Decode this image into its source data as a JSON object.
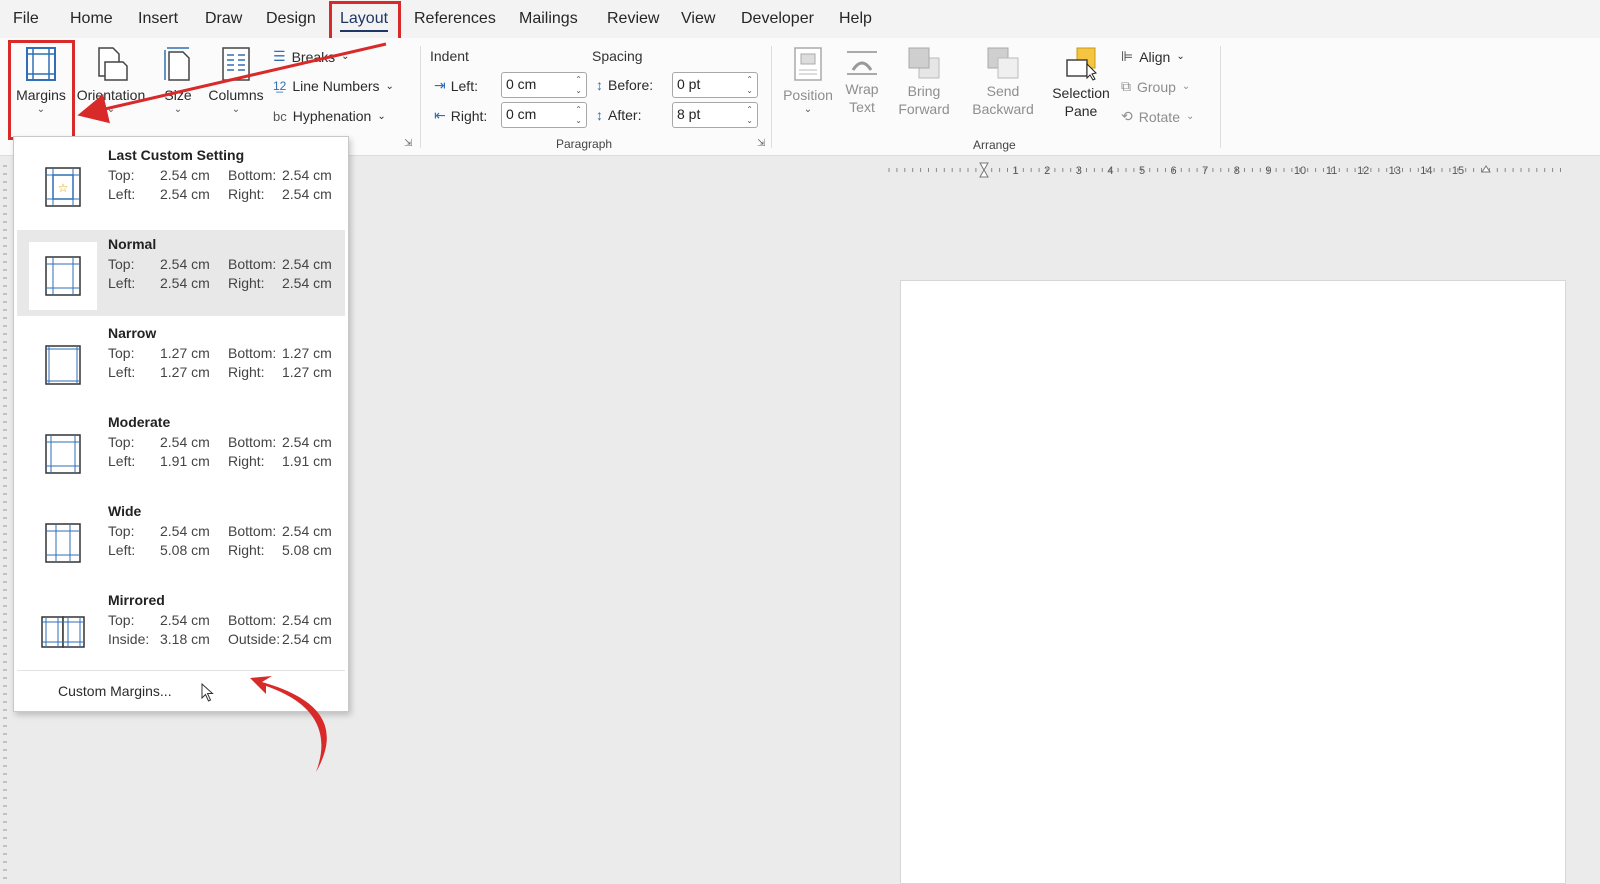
{
  "tabs": [
    "File",
    "Home",
    "Insert",
    "Draw",
    "Design",
    "Layout",
    "References",
    "Mailings",
    "Review",
    "View",
    "Developer",
    "Help"
  ],
  "ribbon": {
    "page_setup": {
      "margins": "Margins",
      "orientation": "Orientation",
      "size": "Size",
      "columns": "Columns",
      "breaks": "Breaks",
      "line_numbers": "Line Numbers",
      "hyphenation": "Hyphenation"
    },
    "paragraph": {
      "indent_header": "Indent",
      "spacing_header": "Spacing",
      "left_label": "Left:",
      "left_value": "0 cm",
      "right_label": "Right:",
      "right_value": "0 cm",
      "before_label": "Before:",
      "before_value": "0 pt",
      "after_label": "After:",
      "after_value": "8 pt",
      "group_label": "Paragraph"
    },
    "arrange": {
      "position": "Position",
      "wrap_text_1": "Wrap",
      "wrap_text_2": "Text",
      "bring_forward_1": "Bring",
      "bring_forward_2": "Forward",
      "send_backward_1": "Send",
      "send_backward_2": "Backward",
      "selection_pane_1": "Selection",
      "selection_pane_2": "Pane",
      "align": "Align",
      "group": "Group",
      "rotate": "Rotate",
      "group_label": "Arrange"
    }
  },
  "margins_menu": {
    "options": [
      {
        "title": "Last Custom Setting",
        "top_label": "Top:",
        "top": "2.54 cm",
        "bottom_label": "Bottom:",
        "bottom": "2.54 cm",
        "left_label": "Left:",
        "left": "2.54 cm",
        "right_label": "Right:",
        "right": "2.54 cm"
      },
      {
        "title": "Normal",
        "top_label": "Top:",
        "top": "2.54 cm",
        "bottom_label": "Bottom:",
        "bottom": "2.54 cm",
        "left_label": "Left:",
        "left": "2.54 cm",
        "right_label": "Right:",
        "right": "2.54 cm"
      },
      {
        "title": "Narrow",
        "top_label": "Top:",
        "top": "1.27 cm",
        "bottom_label": "Bottom:",
        "bottom": "1.27 cm",
        "left_label": "Left:",
        "left": "1.27 cm",
        "right_label": "Right:",
        "right": "1.27 cm"
      },
      {
        "title": "Moderate",
        "top_label": "Top:",
        "top": "2.54 cm",
        "bottom_label": "Bottom:",
        "bottom": "2.54 cm",
        "left_label": "Left:",
        "left": "1.91 cm",
        "right_label": "Right:",
        "right": "1.91 cm"
      },
      {
        "title": "Wide",
        "top_label": "Top:",
        "top": "2.54 cm",
        "bottom_label": "Bottom:",
        "bottom": "2.54 cm",
        "left_label": "Left:",
        "left": "5.08 cm",
        "right_label": "Right:",
        "right": "5.08 cm"
      },
      {
        "title": "Mirrored",
        "top_label": "Top:",
        "top": "2.54 cm",
        "bottom_label": "Bottom:",
        "bottom": "2.54 cm",
        "left_label": "Inside:",
        "left": "3.18 cm",
        "right_label": "Outside:",
        "right": "2.54 cm"
      }
    ],
    "custom_margins": "Custom Margins..."
  },
  "ruler_numbers": [
    "1",
    "2",
    "3",
    "4",
    "5",
    "6",
    "7",
    "8",
    "9",
    "10",
    "11",
    "12",
    "13",
    "14",
    "15"
  ],
  "colors": {
    "accent": "#1f3763",
    "highlight": "#d92a2a",
    "icon_blue": "#2f6fb5",
    "selection_yellow": "#f5c542"
  }
}
